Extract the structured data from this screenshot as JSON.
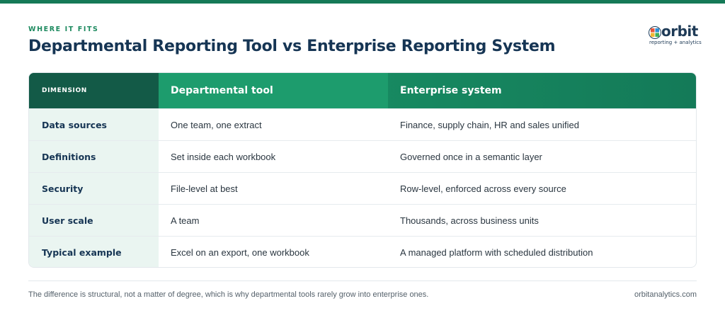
{
  "header": {
    "eyebrow": "WHERE IT FITS",
    "title": "Departmental Reporting Tool vs Enterprise Reporting System"
  },
  "logo": {
    "wordmark": "orbit",
    "tagline": "reporting + analytics",
    "colors": [
      "#e8543a",
      "#2e8fd6",
      "#f2b632",
      "#3fae5a"
    ]
  },
  "table": {
    "columns": [
      "DIMENSION",
      "Departmental tool",
      "Enterprise system"
    ],
    "rows": [
      {
        "dimension": "Data sources",
        "departmental": "One team, one extract",
        "enterprise": "Finance, supply chain, HR and sales unified"
      },
      {
        "dimension": "Definitions",
        "departmental": "Set inside each workbook",
        "enterprise": "Governed once in a semantic layer"
      },
      {
        "dimension": "Security",
        "departmental": "File-level at best",
        "enterprise": "Row-level, enforced across every source"
      },
      {
        "dimension": "User scale",
        "departmental": "A team",
        "enterprise": "Thousands, across business units"
      },
      {
        "dimension": "Typical example",
        "departmental": "Excel on an export, one workbook",
        "enterprise": "A managed platform with scheduled distribution"
      }
    ]
  },
  "footer": {
    "note": "The difference is structural, not a matter of degree, which is why departmental tools rarely grow into enterprise ones.",
    "site": "orbitanalytics.com"
  },
  "colors": {
    "accent": "#157a57",
    "header_dark": "#135a47",
    "title": "#163554",
    "dimension_bg": "#eaf5f1"
  }
}
